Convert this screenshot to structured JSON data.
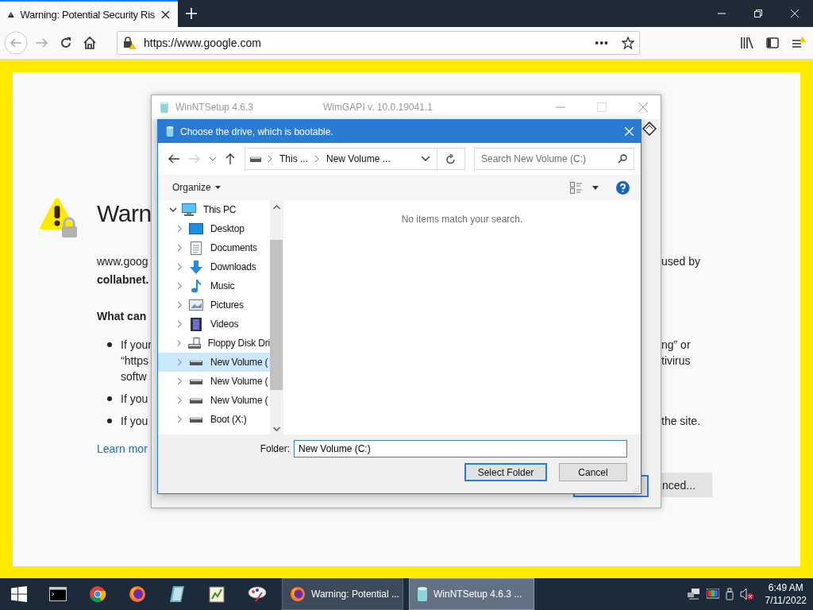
{
  "browser": {
    "tabs": [
      {
        "title": "Warning: Potential Security Ris",
        "selected": true
      }
    ],
    "url": "https://www.google.com",
    "page_actions": "•••"
  },
  "page": {
    "heading": "Warn",
    "lines": [
      {
        "kind": "para",
        "left": "www.goog",
        "right": "used by"
      },
      {
        "kind": "bold",
        "left": "collabnet."
      },
      {
        "kind": "subheading",
        "left": "What can"
      },
      {
        "kind": "bullet",
        "left": "If your",
        "right": "ng” or"
      },
      {
        "kind": "cont",
        "left": "“https",
        "right": "tivirus"
      },
      {
        "kind": "cont",
        "left": "softw"
      },
      {
        "kind": "bullet",
        "left": "If you"
      },
      {
        "kind": "bullet",
        "left": "If you",
        "right": "the site."
      },
      {
        "kind": "link",
        "left": "Learn mor"
      }
    ],
    "button": "nced..."
  },
  "setup_window": {
    "title": "WinNTSetup 4.6.3",
    "subtitle": "WimGAPI v. 10.0.19041.1",
    "active": false
  },
  "dialog": {
    "title": "Choose the drive, which is bootable.",
    "breadcrumb": [
      "This ...",
      "New Volume ..."
    ],
    "search": {
      "placeholder": "Search New Volume (C:)"
    },
    "organize": "Organize",
    "tree": [
      {
        "label": "This PC",
        "kind": "pc",
        "expanded": true,
        "selected": false,
        "children": [
          {
            "label": "Desktop",
            "kind": "desktop",
            "expanded": false,
            "selected": false
          },
          {
            "label": "Documents",
            "kind": "documents",
            "expanded": false,
            "selected": false
          },
          {
            "label": "Downloads",
            "kind": "downloads",
            "expanded": false,
            "selected": false
          },
          {
            "label": "Music",
            "kind": "music",
            "expanded": false,
            "selected": false
          },
          {
            "label": "Pictures",
            "kind": "pictures",
            "expanded": false,
            "selected": false
          },
          {
            "label": "Videos",
            "kind": "videos",
            "expanded": false,
            "selected": false
          },
          {
            "label": "Floppy Disk Dri",
            "kind": "floppy",
            "expanded": false,
            "selected": false
          },
          {
            "label": "New Volume (",
            "kind": "drive",
            "expanded": false,
            "selected": true
          },
          {
            "label": "New Volume (",
            "kind": "drive",
            "expanded": false,
            "selected": false
          },
          {
            "label": "New Volume (",
            "kind": "drive",
            "expanded": false,
            "selected": false
          },
          {
            "label": "Boot (X:)",
            "kind": "drive",
            "expanded": false,
            "selected": false
          }
        ]
      }
    ],
    "empty_message": "No items match your search.",
    "folder_label": "Folder:",
    "folder_value": "New Volume (C:)",
    "buttons": [
      {
        "label": "Select Folder",
        "default": true
      },
      {
        "label": "Cancel",
        "default": false
      }
    ]
  },
  "taskbar": {
    "tasks": [
      {
        "label": "Warning: Potential ...",
        "kind": "firefox",
        "selected": false
      },
      {
        "label": "WinNTSetup 4.6.3  ...",
        "kind": "setup",
        "selected": true
      }
    ],
    "time": "6:49 AM",
    "date": "7/11/2022"
  }
}
